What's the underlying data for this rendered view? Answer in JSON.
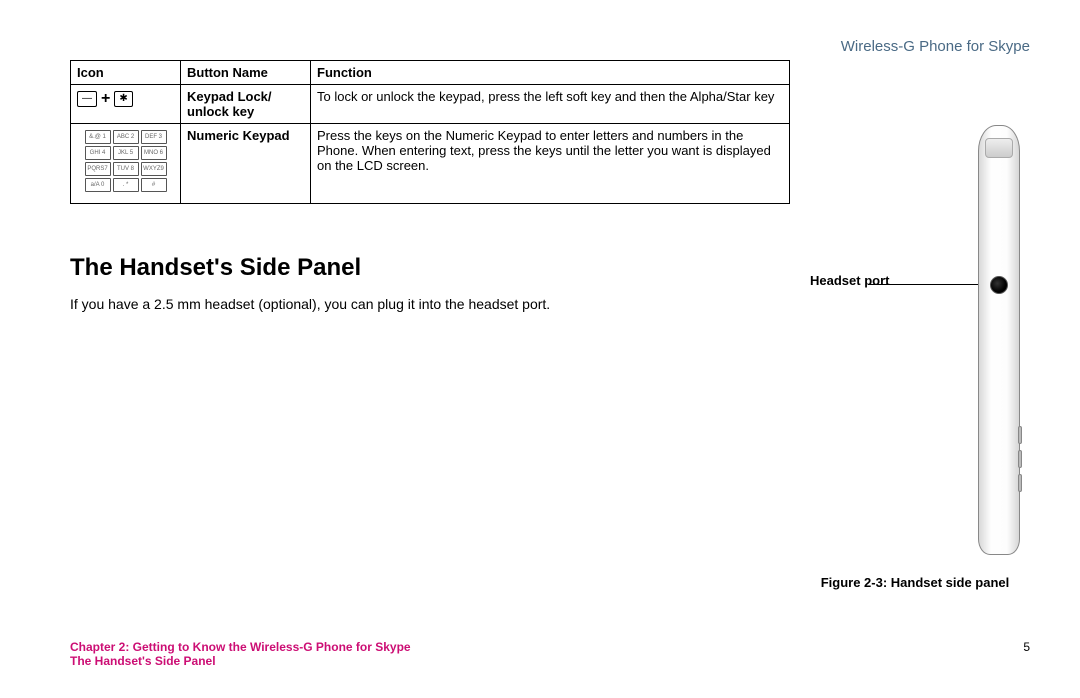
{
  "header": {
    "product": "Wireless-G Phone for Skype"
  },
  "table": {
    "headers": {
      "icon": "Icon",
      "button": "Button Name",
      "func": "Function"
    },
    "rows": [
      {
        "button": "Keypad Lock/ unlock key",
        "func": "To lock or unlock the keypad, press the left soft key and then the Alpha/Star key"
      },
      {
        "button": "Numeric Keypad",
        "func": "Press the keys on the Numeric Keypad to enter letters and numbers in the Phone. When entering text, press the keys until the letter you want is displayed on the LCD screen."
      }
    ]
  },
  "section": {
    "title": "The Handset's Side Panel",
    "body": "If you have a 2.5 mm headset (optional), you can plug it into the headset port."
  },
  "figure": {
    "callout_label": "Headset port",
    "caption": "Figure 2-3: Handset side panel"
  },
  "footer": {
    "chapter": "Chapter 2: Getting to Know the Wireless-G Phone for Skype",
    "section": "The Handset's Side Panel",
    "page": "5"
  },
  "keypad_keys": [
    "&.@ 1",
    "ABC 2",
    "DEF 3",
    "GHI 4",
    "JKL 5",
    "MNO 6",
    "PQRS7",
    "TUV 8",
    "WXYZ9",
    "a/A 0",
    ". *",
    "#"
  ],
  "lock_icon_star": "✱"
}
